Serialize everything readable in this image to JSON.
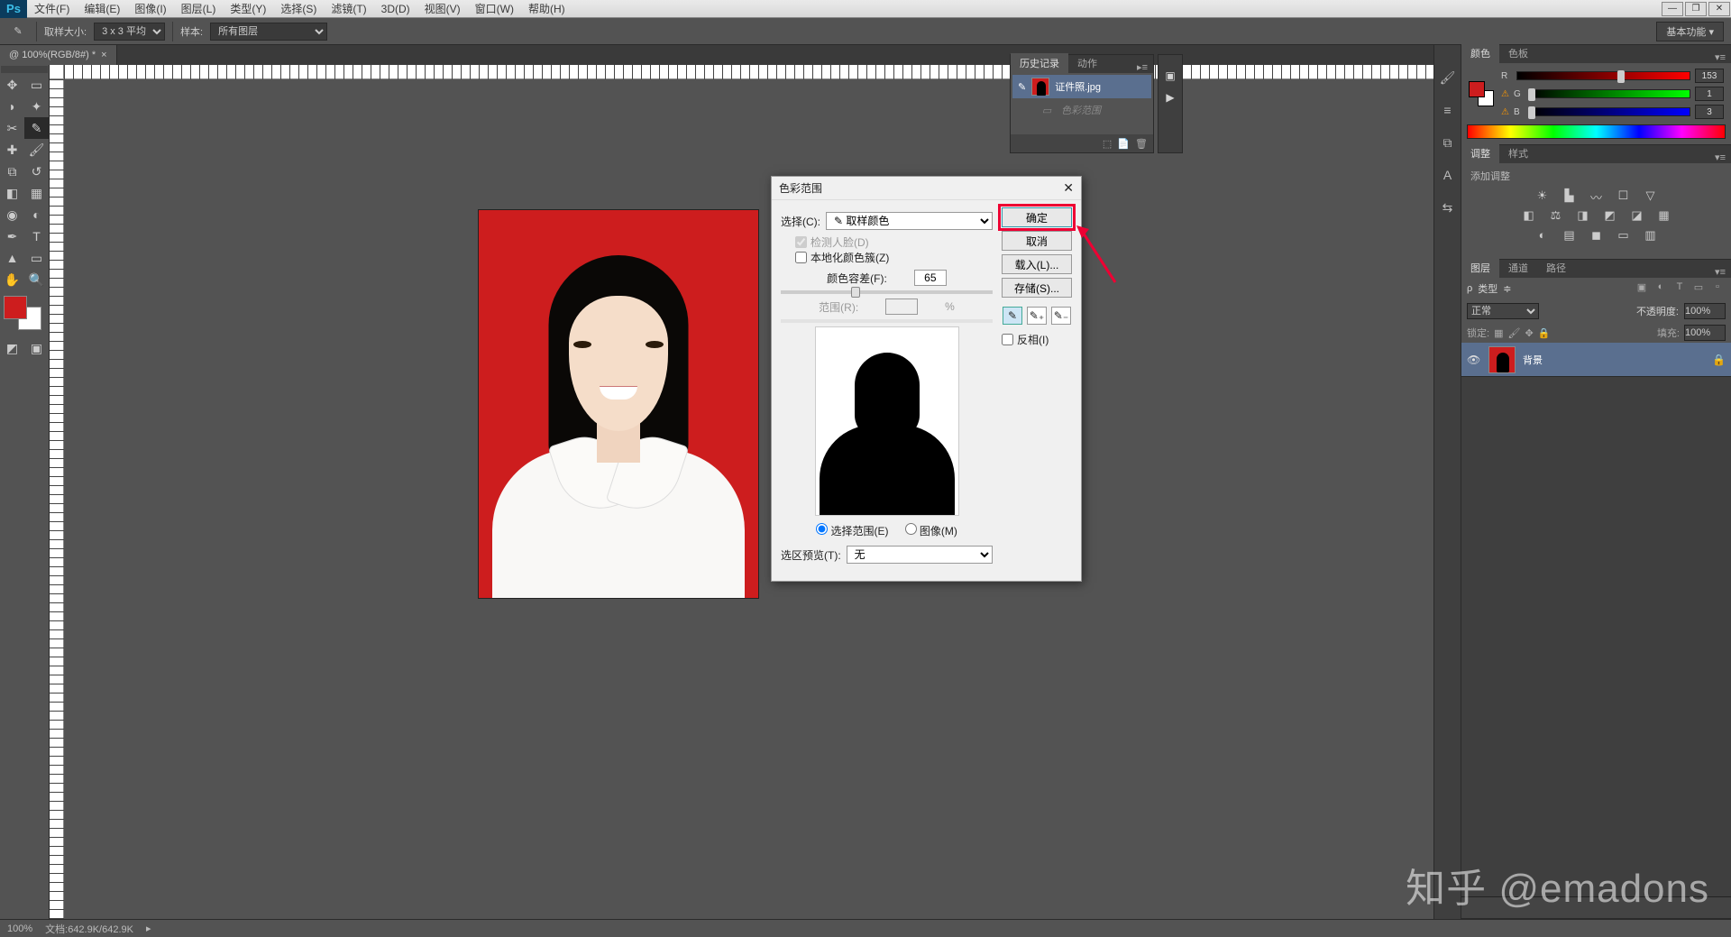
{
  "menu": {
    "items": [
      "文件(F)",
      "编辑(E)",
      "图像(I)",
      "图层(L)",
      "类型(Y)",
      "选择(S)",
      "滤镜(T)",
      "3D(D)",
      "视图(V)",
      "窗口(W)",
      "帮助(H)"
    ]
  },
  "options_bar": {
    "sample_size_label": "取样大小:",
    "sample_size_value": "3 x 3 平均",
    "sample_label": "样本:",
    "sample_value": "所有图层",
    "basic_functions": "基本功能"
  },
  "document": {
    "tab_title": "@ 100%(RGB/8#) *",
    "filename": "证件照.jpg"
  },
  "status_bar": {
    "zoom": "100%",
    "doc_size": "文档:642.9K/642.9K"
  },
  "colors": {
    "foreground": "#cd1d1e",
    "background": "#ffffff"
  },
  "history_panel": {
    "tabs": [
      "历史记录",
      "动作"
    ],
    "active_item": "证件照.jpg",
    "dim_item": "色彩范围"
  },
  "color_panel": {
    "tabs": [
      "颜色",
      "色板"
    ],
    "channels": [
      {
        "label": "R",
        "value": "153",
        "gradient": "linear-gradient(90deg,#000,#f00)",
        "pos": 60
      },
      {
        "label": "G",
        "value": "1",
        "gradient": "linear-gradient(90deg,#000,#0f0)",
        "pos": 1
      },
      {
        "label": "B",
        "value": "3",
        "gradient": "linear-gradient(90deg,#000,#00f)",
        "pos": 1
      }
    ],
    "warn_color": "#cd1d1e"
  },
  "adjustments_panel": {
    "tabs": [
      "调整",
      "样式"
    ],
    "label": "添加调整"
  },
  "layers_panel": {
    "tabs": [
      "图层",
      "通道",
      "路径"
    ],
    "kind_label": "类型",
    "blend_mode": "正常",
    "opacity_label": "不透明度:",
    "opacity_value": "100%",
    "lock_label": "锁定:",
    "fill_label": "填充:",
    "fill_value": "100%",
    "layer_name": "背景"
  },
  "dialog": {
    "title": "色彩范围",
    "select_label": "选择(C):",
    "select_value": "取样颜色",
    "detect_faces": "检测人脸(D)",
    "localized": "本地化颜色簇(Z)",
    "fuzziness_label": "颜色容差(F):",
    "fuzziness_value": "65",
    "range_label": "范围(R):",
    "range_unit": "%",
    "radio_selection": "选择范围(E)",
    "radio_image": "图像(M)",
    "preview_label": "选区预览(T):",
    "preview_value": "无",
    "btn_ok": "确定",
    "btn_cancel": "取消",
    "btn_load": "载入(L)...",
    "btn_save": "存储(S)...",
    "invert": "反相(I)"
  },
  "watermark": "知乎 @emadons"
}
